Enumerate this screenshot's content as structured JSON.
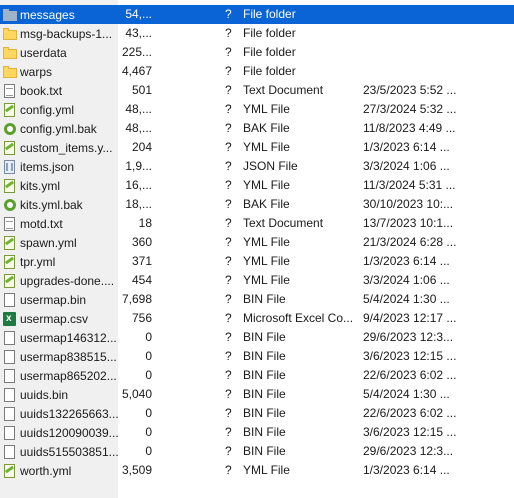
{
  "files": [
    {
      "name": "messages",
      "size": "54,...",
      "attr": "?",
      "type": "File folder",
      "date": "",
      "icon": "folder-icon",
      "selected": true
    },
    {
      "name": "msg-backups-1...",
      "size": "43,...",
      "attr": "?",
      "type": "File folder",
      "date": "",
      "icon": "folder-icon"
    },
    {
      "name": "userdata",
      "size": "225...",
      "attr": "?",
      "type": "File folder",
      "date": "",
      "icon": "folder-icon"
    },
    {
      "name": "warps",
      "size": "4,467",
      "attr": "?",
      "type": "File folder",
      "date": "",
      "icon": "folder-icon"
    },
    {
      "name": "book.txt",
      "size": "501",
      "attr": "?",
      "type": "Text Document",
      "date": "23/5/2023 5:52 ...",
      "icon": "text-document-icon"
    },
    {
      "name": "config.yml",
      "size": "48,...",
      "attr": "?",
      "type": "YML File",
      "date": "27/3/2024 5:32 ...",
      "icon": "yml-file-icon"
    },
    {
      "name": "config.yml.bak",
      "size": "48,...",
      "attr": "?",
      "type": "BAK File",
      "date": "11/8/2023 4:49 ...",
      "icon": "bak-file-icon"
    },
    {
      "name": "custom_items.y...",
      "size": "204",
      "attr": "?",
      "type": "YML File",
      "date": "1/3/2023 6:14 ...",
      "icon": "yml-file-icon"
    },
    {
      "name": "items.json",
      "size": "1,9...",
      "attr": "?",
      "type": "JSON File",
      "date": "3/3/2024 1:06 ...",
      "icon": "json-file-icon"
    },
    {
      "name": "kits.yml",
      "size": "16,...",
      "attr": "?",
      "type": "YML File",
      "date": "11/3/2024 5:31 ...",
      "icon": "yml-file-icon"
    },
    {
      "name": "kits.yml.bak",
      "size": "18,...",
      "attr": "?",
      "type": "BAK File",
      "date": "30/10/2023 10:...",
      "icon": "bak-file-icon"
    },
    {
      "name": "motd.txt",
      "size": "18",
      "attr": "?",
      "type": "Text Document",
      "date": "13/7/2023 10:1...",
      "icon": "text-document-icon"
    },
    {
      "name": "spawn.yml",
      "size": "360",
      "attr": "?",
      "type": "YML File",
      "date": "21/3/2024 6:28 ...",
      "icon": "yml-file-icon"
    },
    {
      "name": "tpr.yml",
      "size": "371",
      "attr": "?",
      "type": "YML File",
      "date": "1/3/2023 6:14 ...",
      "icon": "yml-file-icon"
    },
    {
      "name": "upgrades-done....",
      "size": "454",
      "attr": "?",
      "type": "YML File",
      "date": "3/3/2024 1:06 ...",
      "icon": "yml-file-icon"
    },
    {
      "name": "usermap.bin",
      "size": "7,698",
      "attr": "?",
      "type": "BIN File",
      "date": "5/4/2024 1:30 ...",
      "icon": "bin-file-icon"
    },
    {
      "name": "usermap.csv",
      "size": "756",
      "attr": "?",
      "type": "Microsoft Excel Co...",
      "date": "9/4/2023 12:17 ...",
      "icon": "excel-csv-icon"
    },
    {
      "name": "usermap146312...",
      "size": "0",
      "attr": "?",
      "type": "BIN File",
      "date": "29/6/2023 12:3...",
      "icon": "bin-file-icon"
    },
    {
      "name": "usermap838515...",
      "size": "0",
      "attr": "?",
      "type": "BIN File",
      "date": "3/6/2023 12:15 ...",
      "icon": "bin-file-icon"
    },
    {
      "name": "usermap865202...",
      "size": "0",
      "attr": "?",
      "type": "BIN File",
      "date": "22/6/2023 6:02 ...",
      "icon": "bin-file-icon"
    },
    {
      "name": "uuids.bin",
      "size": "5,040",
      "attr": "?",
      "type": "BIN File",
      "date": "5/4/2024 1:30 ...",
      "icon": "bin-file-icon"
    },
    {
      "name": "uuids132265663...",
      "size": "0",
      "attr": "?",
      "type": "BIN File",
      "date": "22/6/2023 6:02 ...",
      "icon": "bin-file-icon"
    },
    {
      "name": "uuids120090039...",
      "size": "0",
      "attr": "?",
      "type": "BIN File",
      "date": "3/6/2023 12:15 ...",
      "icon": "bin-file-icon"
    },
    {
      "name": "uuids515503851...",
      "size": "0",
      "attr": "?",
      "type": "BIN File",
      "date": "29/6/2023 12:3...",
      "icon": "bin-file-icon"
    },
    {
      "name": "worth.yml",
      "size": "3,509",
      "attr": "?",
      "type": "YML File",
      "date": "1/3/2023 6:14 ...",
      "icon": "yml-file-icon"
    }
  ],
  "colors": {
    "selection": "#0a64d6",
    "gutter": "#f0f0f0"
  }
}
